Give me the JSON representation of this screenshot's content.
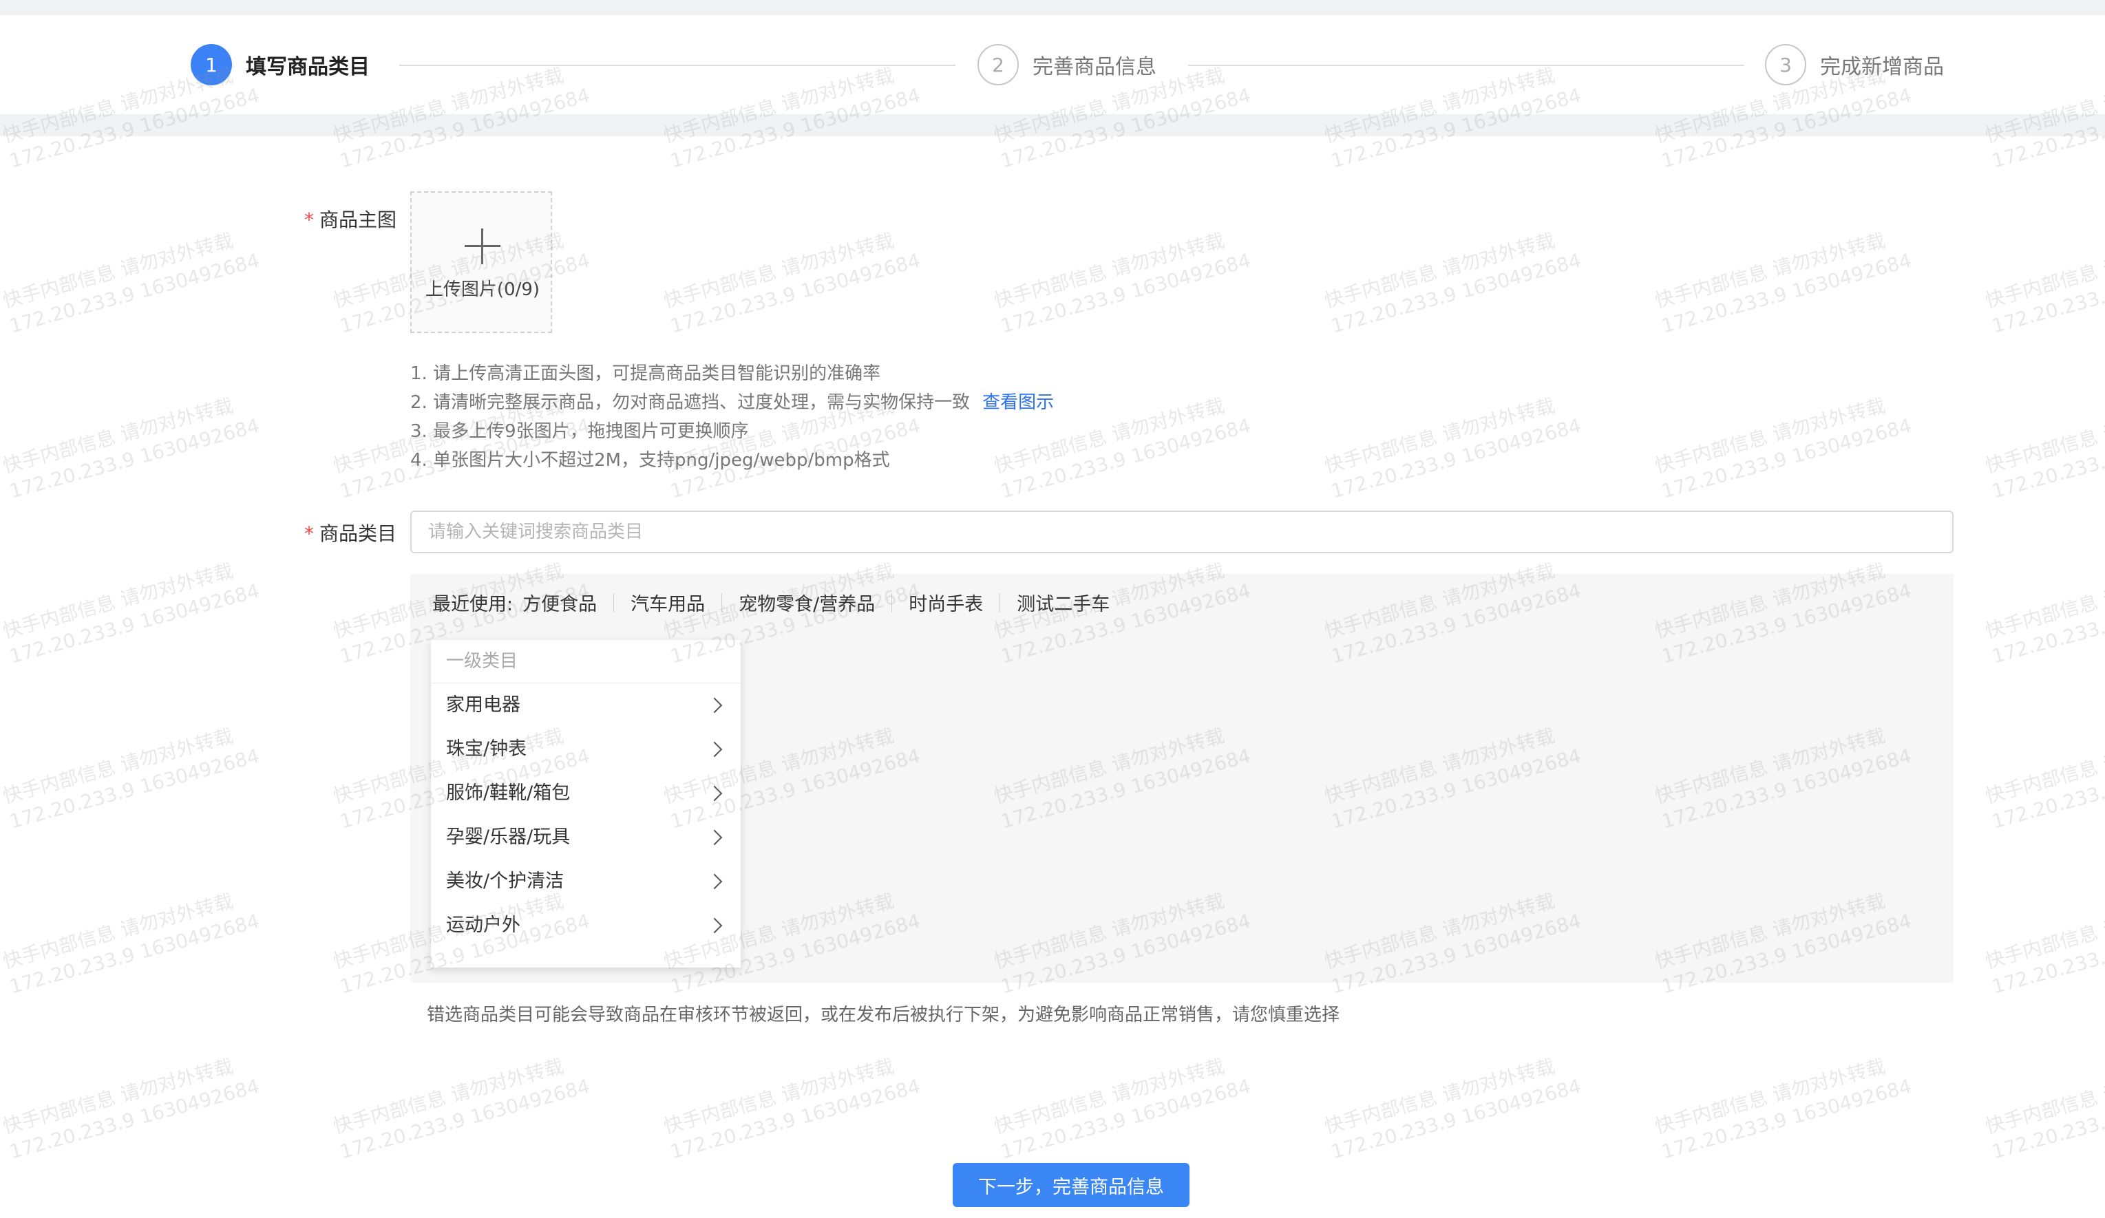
{
  "steps": [
    {
      "num": "1",
      "label": "填写商品类目"
    },
    {
      "num": "2",
      "label": "完善商品信息"
    },
    {
      "num": "3",
      "label": "完成新增商品"
    }
  ],
  "main_image": {
    "label": "商品主图",
    "required_mark": "*",
    "upload_label": "上传图片(0/9)",
    "tips": [
      "1. 请上传高清正面头图，可提高商品类目智能识别的准确率",
      "2. 请清晰完整展示商品，勿对商品遮挡、过度处理，需与实物保持一致",
      "3. 最多上传9张图片，拖拽图片可更换顺序",
      "4. 单张图片大小不超过2M，支持png/jpeg/webp/bmp格式"
    ],
    "view_example_link": "查看图示"
  },
  "category": {
    "label": "商品类目",
    "required_mark": "*",
    "search_placeholder": "请输入关键词搜索商品类目",
    "recent_label": "最近使用:",
    "recent_items": [
      "方便食品",
      "汽车用品",
      "宠物零食/营养品",
      "时尚手表",
      "测试二手车"
    ],
    "level1_header": "一级类目",
    "level1_items": [
      "家用电器",
      "珠宝/钟表",
      "服饰/鞋靴/箱包",
      "孕婴/乐器/玩具",
      "美妆/个护清洁",
      "运动户外"
    ],
    "warning": "错选商品类目可能会导致商品在审核环节被返回，或在发布后被执行下架，为避免影响商品正常销售，请您慎重选择"
  },
  "next_button": "下一步，完善商品信息",
  "watermark": {
    "line1": "快手内部信息 请勿对外转载",
    "line2": "172.20.233.9 1630492684"
  },
  "colors": {
    "primary": "#3b82f6",
    "required": "#f24a4a",
    "link": "#2f74f0",
    "panel_bg": "#f6f6f6"
  }
}
